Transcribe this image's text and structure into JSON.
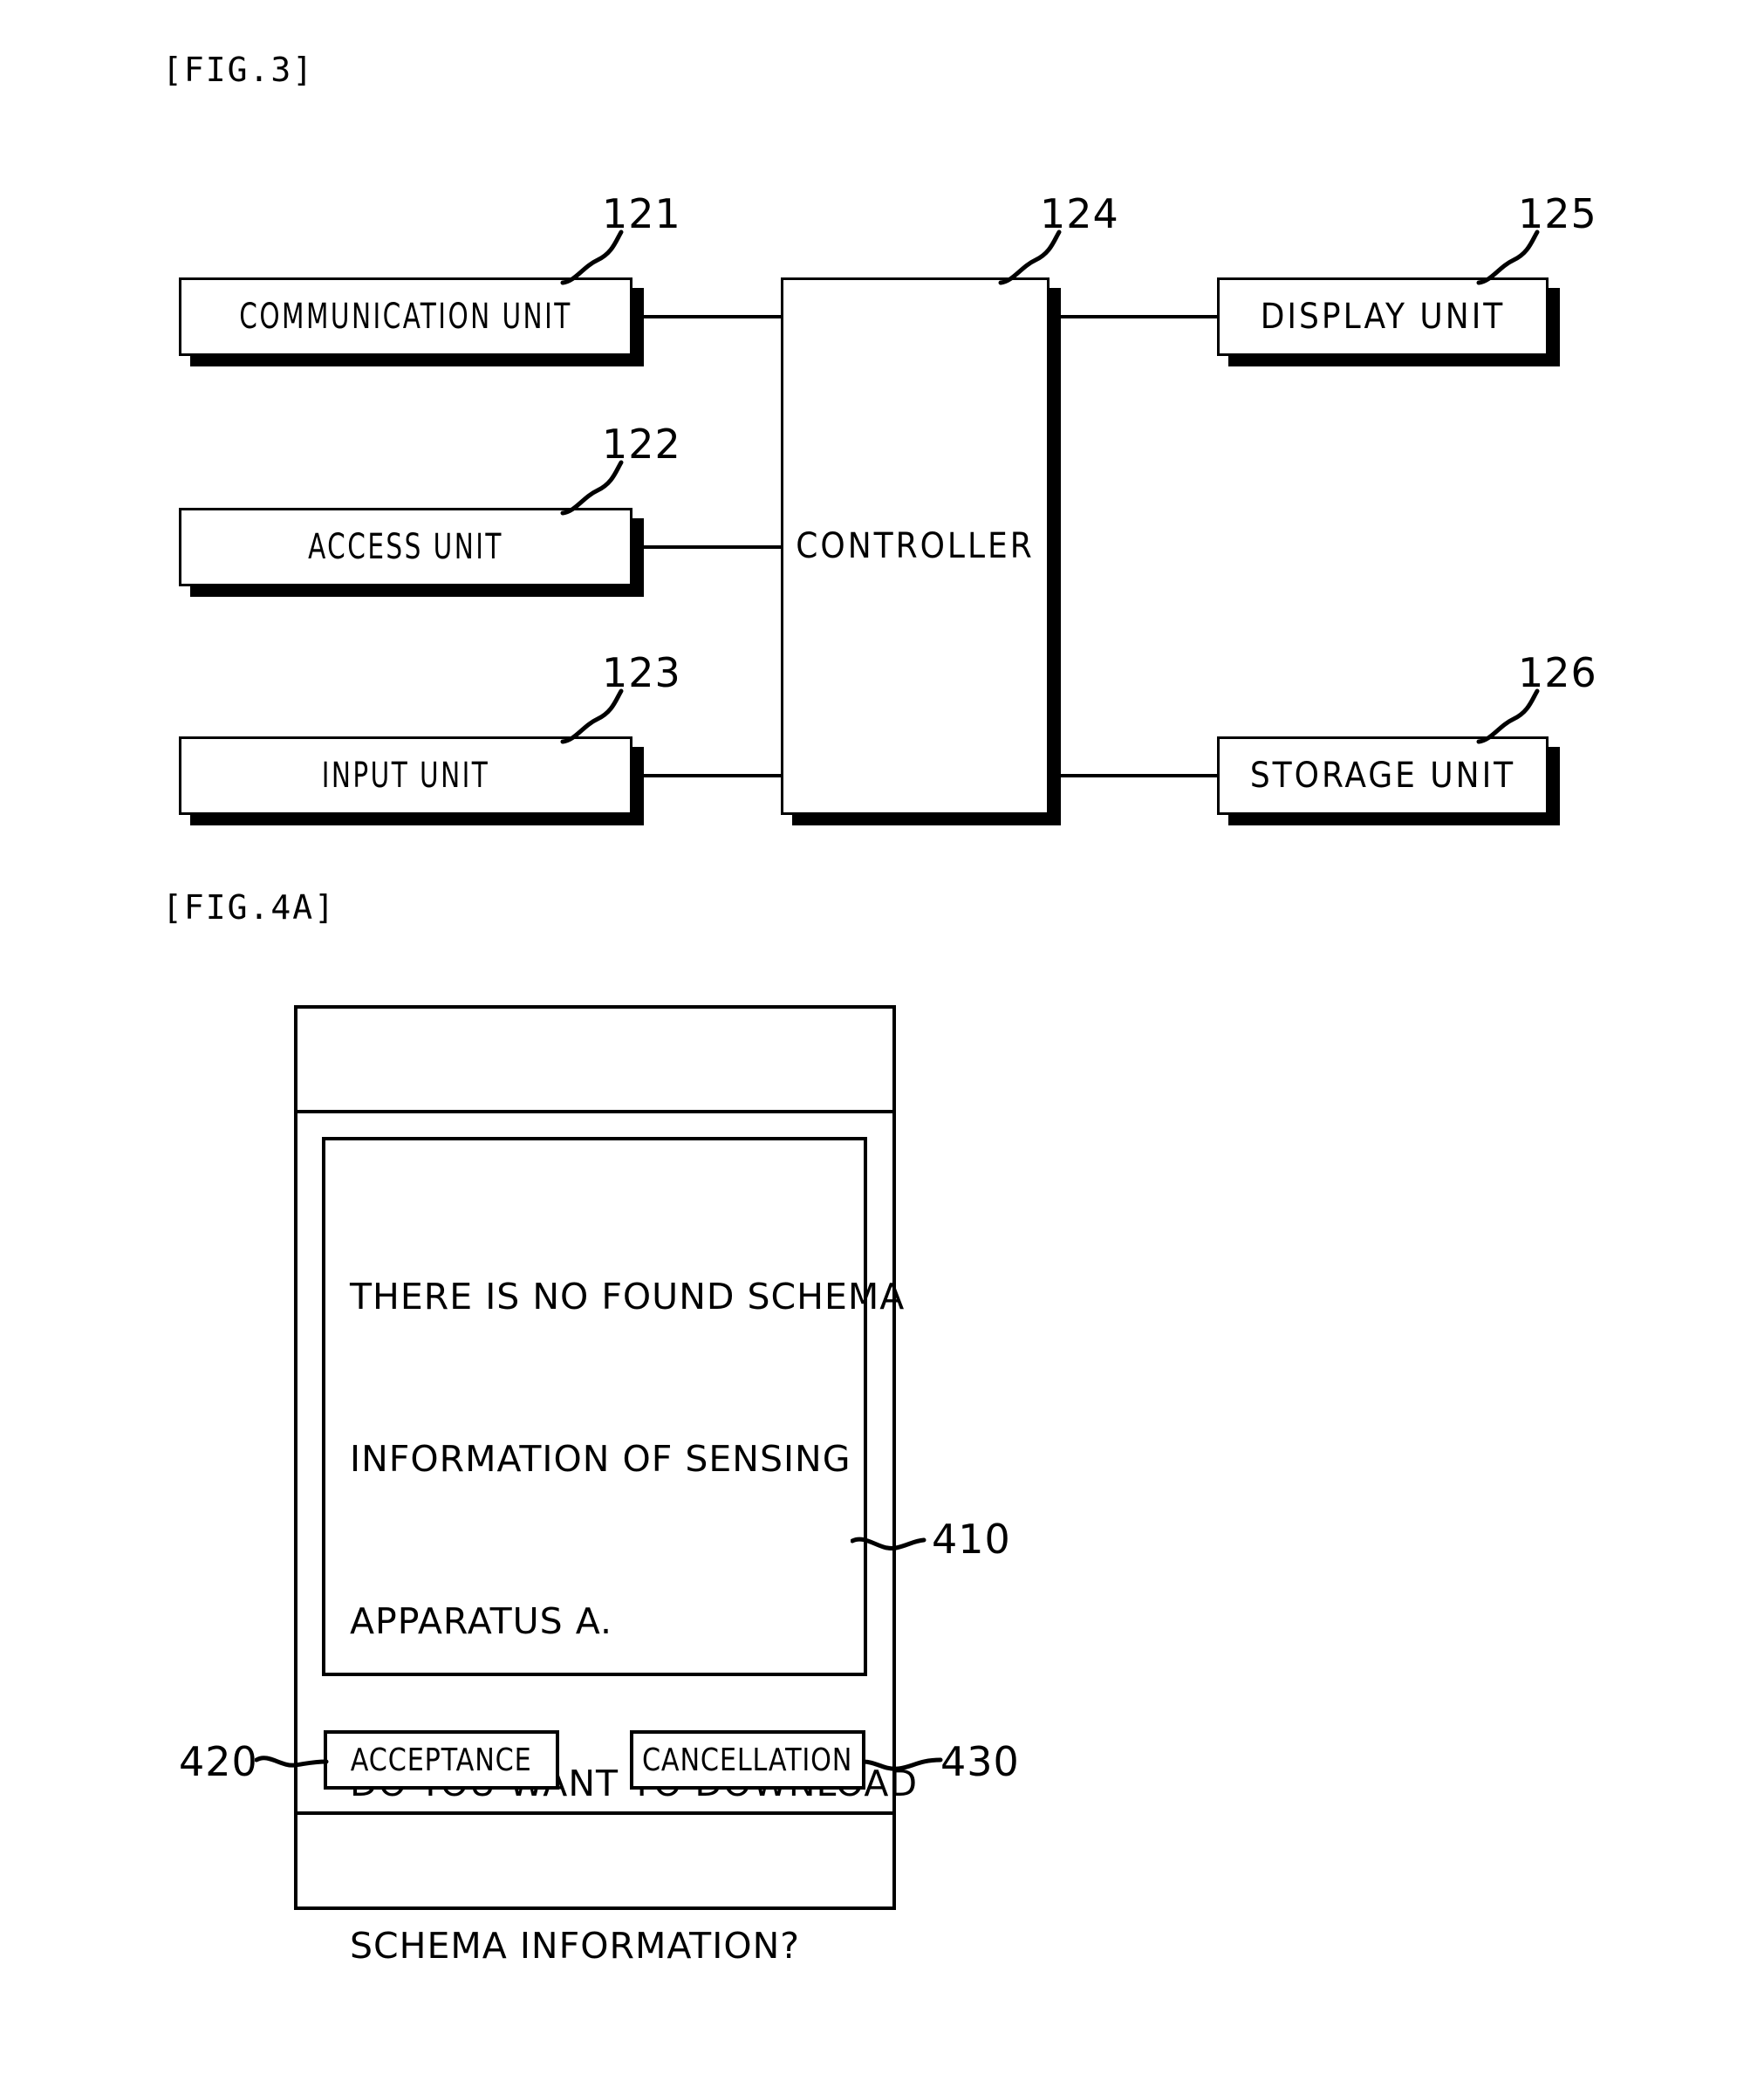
{
  "figures": [
    {
      "caption": "[FIG.3]"
    },
    {
      "caption": "[FIG.4A]"
    }
  ],
  "fig3": {
    "caption": "[FIG.3]",
    "blocks": [
      {
        "id": "communication-unit",
        "label": "COMMUNICATION UNIT",
        "ref": "121"
      },
      {
        "id": "access-unit",
        "label": "ACCESS UNIT",
        "ref": "122"
      },
      {
        "id": "input-unit",
        "label": "INPUT UNIT",
        "ref": "123"
      },
      {
        "id": "controller",
        "label": "CONTROLLER",
        "ref": "124"
      },
      {
        "id": "display-unit",
        "label": "DISPLAY UNIT",
        "ref": "125"
      },
      {
        "id": "storage-unit",
        "label": "STORAGE UNIT",
        "ref": "126"
      }
    ]
  },
  "fig4a": {
    "caption": "[FIG.4A]",
    "dialog": {
      "ref": "410",
      "lines": [
        "THERE IS NO FOUND SCHEMA",
        "INFORMATION OF SENSING",
        "APPARATUS A.",
        "DO YOU WANT TO DOWNLOAD",
        "SCHEMA INFORMATION?"
      ]
    },
    "buttons": [
      {
        "id": "acceptance",
        "label": "ACCEPTANCE",
        "ref": "420"
      },
      {
        "id": "cancellation",
        "label": "CANCELLATION",
        "ref": "430"
      }
    ]
  },
  "colors": {
    "ink": "#000000",
    "paper": "#ffffff"
  }
}
